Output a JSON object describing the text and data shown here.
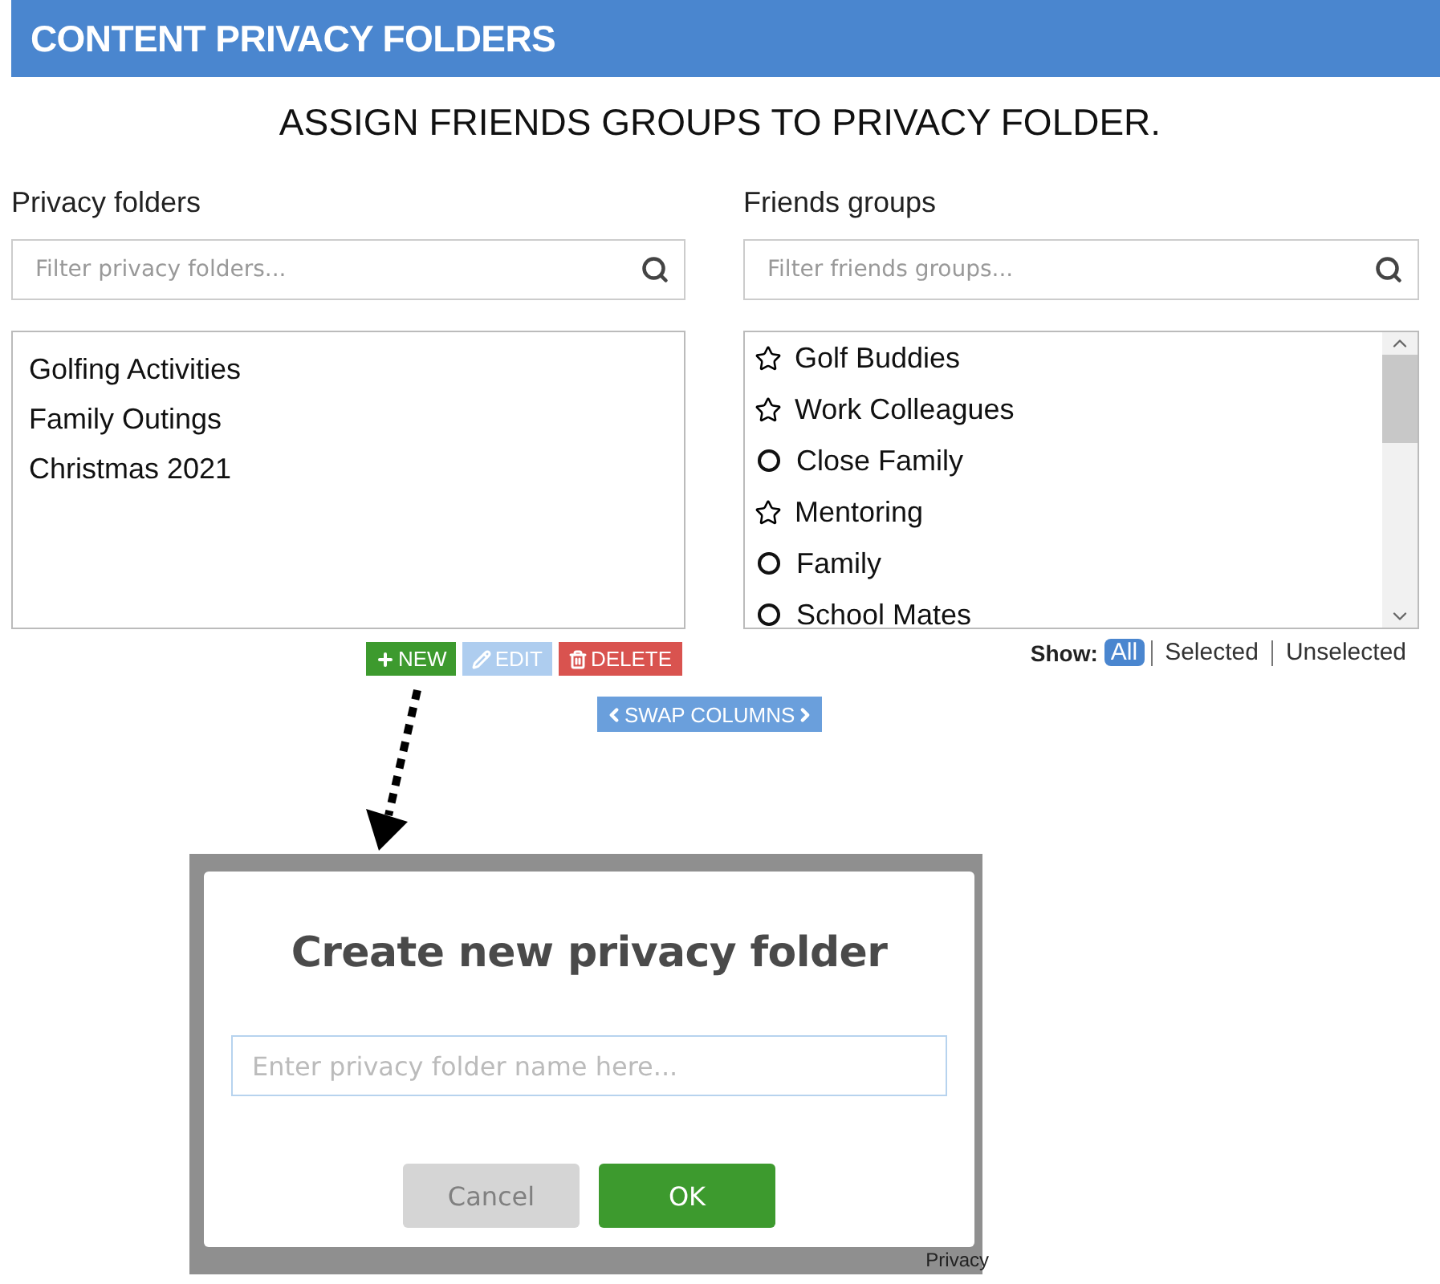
{
  "header": {
    "title": "CONTENT PRIVACY FOLDERS"
  },
  "heading": "ASSIGN FRIENDS GROUPS TO PRIVACY FOLDER.",
  "privacy_folders": {
    "label": "Privacy folders",
    "search": {
      "placeholder": "Filter privacy folders..."
    },
    "items": [
      "Golfing Activities",
      "Family Outings",
      "Christmas 2021"
    ],
    "buttons": [
      {
        "kind": "new",
        "label": "NEW",
        "disabled": false
      },
      {
        "kind": "edit",
        "label": "EDIT",
        "disabled": true
      },
      {
        "kind": "delete",
        "label": "DELETE",
        "disabled": false
      }
    ]
  },
  "friends_groups": {
    "label": "Friends groups",
    "search": {
      "placeholder": "Filter friends groups..."
    },
    "items": [
      {
        "kind": "star",
        "label": "Golf Buddies"
      },
      {
        "kind": "star",
        "label": "Work Colleagues"
      },
      {
        "kind": "circle",
        "label": "Close Family"
      },
      {
        "kind": "star",
        "label": "Mentoring"
      },
      {
        "kind": "circle",
        "label": "Family"
      },
      {
        "kind": "circle",
        "label": "School Mates"
      }
    ],
    "show": {
      "label": "Show:",
      "options": [
        {
          "label": "All",
          "selected": true
        },
        {
          "label": "Selected",
          "selected": false
        },
        {
          "label": "Unselected",
          "selected": false
        }
      ]
    }
  },
  "swap_button": "SWAP COLUMNS",
  "dialog": {
    "title": "Create new privacy folder",
    "input": {
      "placeholder": "Enter privacy folder name here..."
    },
    "buttons": [
      {
        "kind": "cancel",
        "label": "Cancel",
        "disabled": true
      },
      {
        "kind": "ok",
        "label": "OK",
        "disabled": false
      }
    ],
    "background_text": "Privacy"
  }
}
